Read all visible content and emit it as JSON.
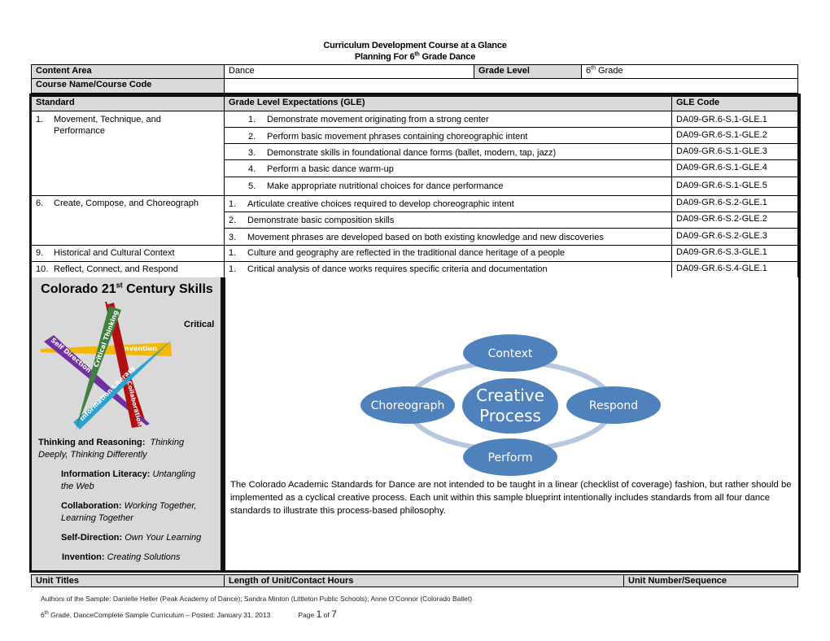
{
  "header": {
    "title": "Curriculum Development Course at a Glance",
    "subtitle_prefix": "Planning For 6",
    "subtitle_sup": "th",
    "subtitle_suffix": " Grade Dance"
  },
  "info": {
    "content_area_label": "Content Area",
    "content_area_value": "Dance",
    "grade_level_label": "Grade Level",
    "grade_level_value_num": "6",
    "grade_level_value_sup": "th",
    "grade_level_value_suffix": " Grade",
    "course_name_label": "Course Name/Course Code",
    "course_name_value": ""
  },
  "standards_table": {
    "headers": {
      "standard": "Standard",
      "gle": "Grade Level Expectations (GLE)",
      "code": "GLE Code"
    },
    "standards": [
      {
        "num": "1.",
        "name_line1": "Movement, Technique, and",
        "name_line2": "Performance",
        "gles": [
          {
            "num": "1.",
            "text": "Demonstrate movement originating from a strong center",
            "code": "DA09-GR.6-S.1-GLE.1"
          },
          {
            "num": "2.",
            "text": "Perform basic movement phrases containing choreographic intent",
            "code": "DA09-GR.6-S.1-GLE.2"
          },
          {
            "num": "3.",
            "text": "Demonstrate skills in foundational dance forms (ballet, modern, tap, jazz)",
            "code": "DA09-GR.6-S.1-GLE.3"
          },
          {
            "num": "4.",
            "text": "Perform a basic dance warm-up",
            "code": "DA09-GR.6-S.1-GLE.4"
          },
          {
            "num": "5.",
            "text": "Make appropriate nutritional choices for dance performance",
            "code": "DA09-GR.6-S.1-GLE.5"
          }
        ]
      },
      {
        "num": "6.",
        "name_line1": "Create, Compose, and Choreograph",
        "name_line2": "",
        "gles": [
          {
            "num": "1.",
            "text": "Articulate creative choices required to develop choreographic intent",
            "code": "DA09-GR.6-S.2-GLE.1"
          },
          {
            "num": "2.",
            "text": "Demonstrate basic composition skills",
            "code": "DA09-GR.6-S.2-GLE.2"
          },
          {
            "num": "3.",
            "text": "Movement phrases are developed based on both existing knowledge and new discoveries",
            "code": "DA09-GR.6-S.2-GLE.3"
          }
        ]
      },
      {
        "num": "9.",
        "name_line1": "Historical and Cultural Context",
        "name_line2": "",
        "gles": [
          {
            "num": "1.",
            "text": "Culture and geography are reflected in the traditional dance heritage of a people",
            "code": "DA09-GR.6-S.3-GLE.1"
          }
        ]
      },
      {
        "num": "10.",
        "name_line1": "Reflect, Connect, and Respond",
        "name_line2": "",
        "gles": [
          {
            "num": "1.",
            "text": "Critical analysis of dance works requires specific criteria and documentation",
            "code": "DA09-GR.6-S.4-GLE.1"
          }
        ]
      }
    ]
  },
  "skills": {
    "title_prefix": "Colorado 21",
    "title_sup": "st",
    "title_suffix": " Century Skills",
    "critical_label": "Critical",
    "star_labels": {
      "critical_thinking": "Critical Thinking",
      "invention": "Invention",
      "self_direction": "Self Direction",
      "information_literacy": "Information Literacy",
      "collaboration": "Collaboration"
    },
    "star_colors": {
      "critical_thinking": "#3f7f3f",
      "invention": "#f5b800",
      "self_direction": "#7030a0",
      "information_literacy": "#2ba3d0",
      "collaboration": "#b01010",
      "thin_line": "#c00000"
    },
    "items": [
      {
        "label": "Thinking and Reasoning:",
        "desc": "Thinking",
        "desc2": "Deeply, Thinking Differently"
      },
      {
        "label": "Information Literacy:",
        "desc": "Untangling",
        "desc2": "the Web"
      },
      {
        "label": "Collaboration:",
        "desc": "Working Together,",
        "desc2": "Learning Together"
      },
      {
        "label": "Self-Direction:",
        "desc": "Own Your Learning"
      },
      {
        "label": "Invention:",
        "desc": "Creating Solutions"
      }
    ]
  },
  "cycle": {
    "center_line1": "Creative",
    "center_line2": "Process",
    "nodes": {
      "top": "Context",
      "right": "Respond",
      "bottom": "Perform",
      "left": "Choreograph"
    },
    "node_color": "#4f81bd",
    "ring_color": "#b8c7e0"
  },
  "paragraph": "The Colorado Academic Standards for Dance are not intended to be taught in a linear (checklist of coverage) fashion, but rather should be implemented as a cyclical creative process. Each unit within this sample blueprint intentionally includes standards from all four dance standards to illustrate this process-based philosophy.",
  "unit_table": {
    "headers": {
      "titles": "Unit Titles",
      "length": "Length of Unit/Contact Hours",
      "number": "Unit Number/Sequence"
    }
  },
  "footer": {
    "authors": "Authors of the Sample: Danielle Heller (Peak Academy of Dance); Sandra Minton (Littleton Public Schools); Anne O’Connor (Colorado Ballet)",
    "grade_num": "6",
    "grade_sup": "th",
    "doc_line": " Grade, DanceComplete Sample Curriculum – Posted: January 31, 2013",
    "page_word": "Page ",
    "page_current": "1",
    "page_of": " of ",
    "page_total": "7"
  }
}
